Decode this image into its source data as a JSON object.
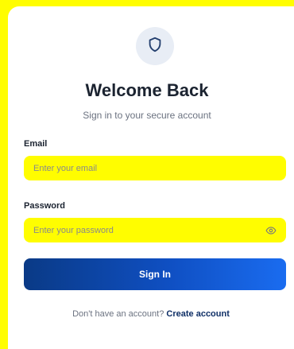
{
  "header": {
    "logo_icon": "shield-icon",
    "title": "Welcome Back",
    "subtitle": "Sign in to your secure account"
  },
  "form": {
    "email_label": "Email",
    "email_placeholder": "Enter your email",
    "password_label": "Password",
    "password_placeholder": "Enter your password",
    "password_toggle_icon": "eye-icon",
    "submit_label": "Sign In"
  },
  "footer": {
    "prompt_text": "Don't have an account?",
    "link_text": "Create account"
  },
  "colors": {
    "background": "#fffd00",
    "field_highlight": "#fffd00",
    "button_gradient_start": "#0a3a86",
    "button_gradient_end": "#1a6cf0",
    "title": "#1b2330"
  }
}
